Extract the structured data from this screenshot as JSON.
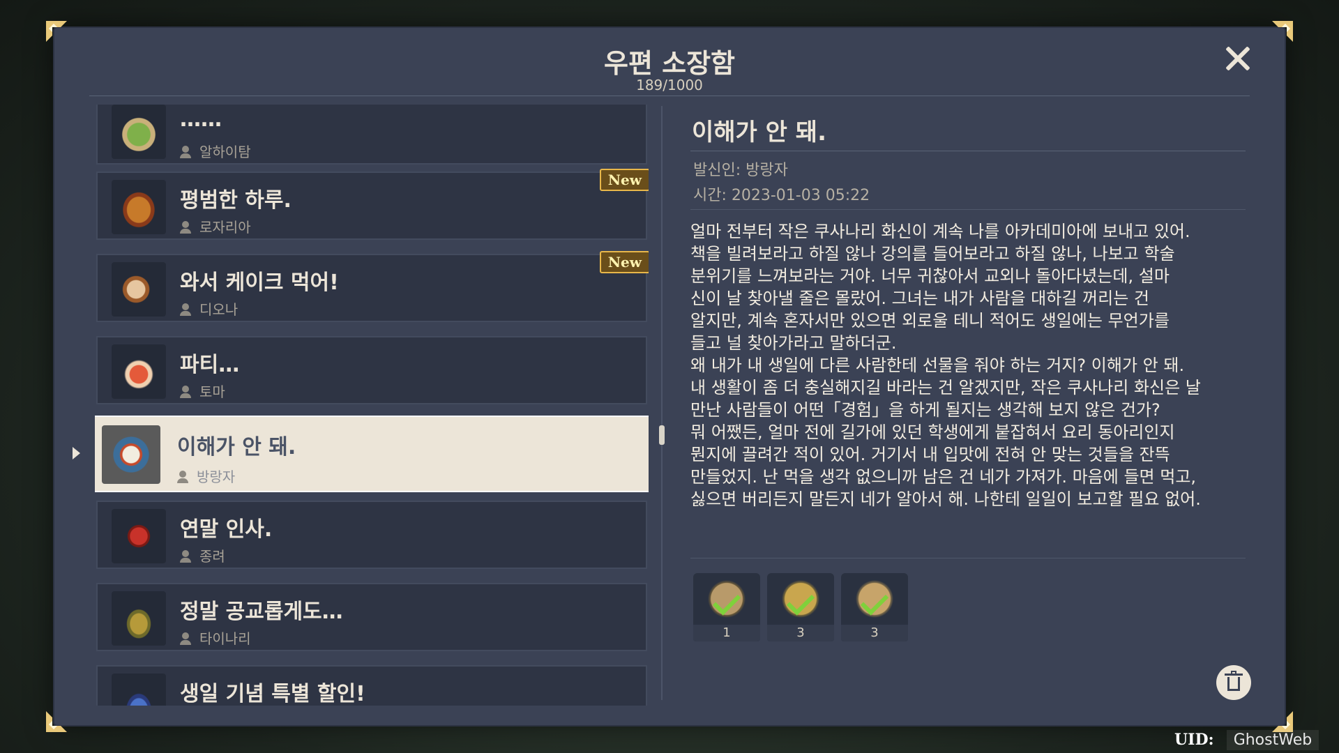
{
  "header": {
    "title": "우편 소장함",
    "count": "189/1000"
  },
  "mail_list": [
    {
      "subject": "……",
      "sender": "알하이탐",
      "new_badge": ""
    },
    {
      "subject": "평범한 하루.",
      "sender": "로자리아",
      "new_badge": "New"
    },
    {
      "subject": "와서 케이크 먹어!",
      "sender": "디오나",
      "new_badge": "New"
    },
    {
      "subject": "파티…",
      "sender": "토마",
      "new_badge": ""
    },
    {
      "subject": "이해가 안 돼.",
      "sender": "방랑자",
      "new_badge": "",
      "selected": true
    },
    {
      "subject": "연말 인사.",
      "sender": "종려",
      "new_badge": ""
    },
    {
      "subject": "정말 공교롭게도…",
      "sender": "타이나리",
      "new_badge": ""
    },
    {
      "subject": "생일 기념 특별 할인!",
      "sender": "",
      "new_badge": ""
    }
  ],
  "detail": {
    "title": "이해가 안 돼.",
    "sender": "발신인: 방랑자",
    "time": "시간: 2023-01-03 05:22",
    "body": "얼마 전부터 작은 쿠사나리 화신이 계속 나를 아카데미아에 보내고 있어.\n책을 빌려보라고 하질 않나 강의를 들어보라고 하질 않나, 나보고 학술\n분위기를 느껴보라는 거야. 너무 귀찮아서 교외나 돌아다녔는데, 설마\n신이 날 찾아낼 줄은 몰랐어. 그녀는 내가 사람을 대하길 꺼리는 건\n알지만, 계속 혼자서만 있으면 외로울 테니 적어도 생일에는 무언가를\n들고 널 찾아가라고 말하더군.\n왜 내가 내 생일에 다른 사람한테 선물을 줘야 하는 거지? 이해가 안 돼.\n내 생활이 좀 더 충실해지길 바라는 건 알겠지만, 작은 쿠사나리 화신은 날\n만난 사람들이 어떤「경험」을 하게 될지는 생각해 보지 않은 건가?\n뭐 어쨌든, 얼마 전에 길가에 있던 학생에게 붙잡혀서 요리 동아리인지\n뭔지에 끌려간 적이 있어. 거기서 내 입맛에 전혀 안 맞는 것들을 잔뜩\n만들었지. 난 먹을 생각 없으니까 남은 건 네가 가져가. 마음에 들면 먹고,\n싫으면 버리든지 말든지 네가 알아서 해. 나한테 일일이 보고할 필요 없어.",
    "rewards": [
      {
        "qty": "1",
        "icon": "rice-bowl-dish",
        "color": "#b89a6a"
      },
      {
        "qty": "3",
        "icon": "fried-dish",
        "color": "#c9a64e"
      },
      {
        "qty": "3",
        "icon": "tofu-dish",
        "color": "#c7a46a"
      }
    ]
  },
  "footer": {
    "uid_label": "UID:",
    "uid_value": "GhostWeb"
  },
  "colors": {
    "panel": "#3b4255",
    "accent_gold": "#e8b74a",
    "selected_bg": "#ece5d8",
    "check_green": "#7fd13b"
  }
}
